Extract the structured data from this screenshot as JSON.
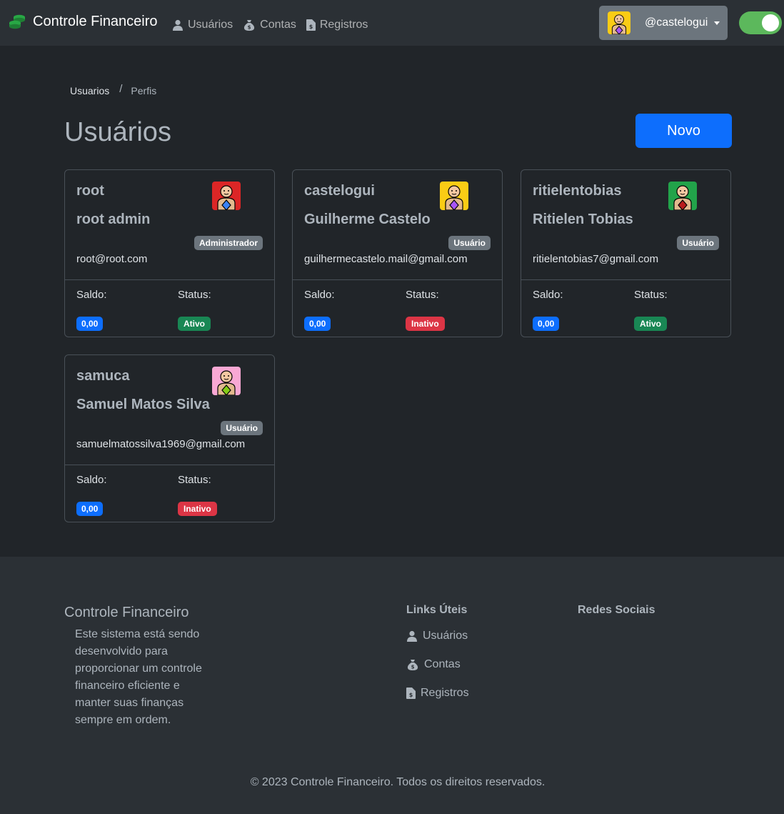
{
  "navbar": {
    "brand": "Controle Financeiro",
    "links": [
      {
        "label": "Usuários",
        "icon": "user-icon"
      },
      {
        "label": "Contas",
        "icon": "money-bag-icon"
      },
      {
        "label": "Registros",
        "icon": "file-invoice-dollar-icon"
      }
    ],
    "user": "@castelogui",
    "theme_toggle_on": true,
    "colors": {
      "brand_icon": "#28a745",
      "toggle": "#5cb85c"
    }
  },
  "breadcrumb": {
    "items": [
      "Usuarios",
      "Perfis"
    ],
    "separator": "/"
  },
  "header": {
    "title": "Usuários",
    "new_button": "Novo"
  },
  "labels": {
    "saldo": "Saldo:",
    "status": "Status:"
  },
  "users": [
    {
      "username": "root",
      "full_name": "root admin",
      "role": "Administrador",
      "email": "root@root.com",
      "saldo": "0,00",
      "status": "Ativo",
      "status_color": "#198754",
      "avatar_bg": "#dc2626",
      "avatar_shirt": "#3b82f6"
    },
    {
      "username": "castelogui",
      "full_name": "Guilherme Castelo",
      "role": "Usuário",
      "email": "guilhermecastelo.mail@gmail.com",
      "saldo": "0,00",
      "status": "Inativo",
      "status_color": "#dc3545",
      "avatar_bg": "#facc15",
      "avatar_shirt": "#a855f7"
    },
    {
      "username": "ritielentobias",
      "full_name": "Ritielen Tobias",
      "role": "Usuário",
      "email": "ritielentobias7@gmail.com",
      "saldo": "0,00",
      "status": "Ativo",
      "status_color": "#198754",
      "avatar_bg": "#22a34a",
      "avatar_shirt": "#b91c1c"
    },
    {
      "username": "samuca",
      "full_name": "Samuel Matos Silva",
      "role": "Usuário",
      "email": "samuelmatossilva1969@gmail.com",
      "saldo": "0,00",
      "status": "Inativo",
      "status_color": "#dc3545",
      "avatar_bg": "#f9a8d4",
      "avatar_shirt": "#84cc16"
    }
  ],
  "footer": {
    "title": "Controle Financeiro",
    "description": "Este sistema está sendo desenvolvido para proporcionar um controle financeiro eficiente e manter suas finanças sempre em ordem.",
    "links_title": "Links Úteis",
    "links": [
      {
        "label": "Usuários",
        "icon": "user-icon"
      },
      {
        "label": "Contas",
        "icon": "money-bag-icon"
      },
      {
        "label": "Registros",
        "icon": "file-invoice-dollar-icon"
      }
    ],
    "social_title": "Redes Sociais",
    "copyright": "© 2023 Controle Financeiro. Todos os direitos reservados."
  }
}
